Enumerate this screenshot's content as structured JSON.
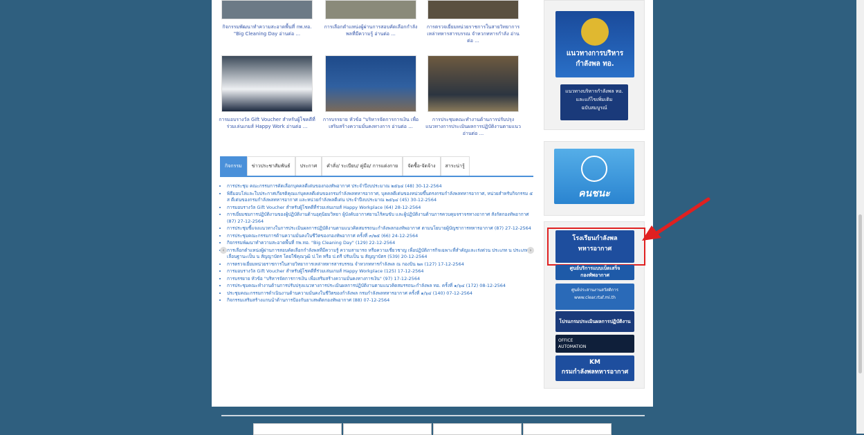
{
  "news_top": [
    {
      "caption": "กิจกรรมพัฒนาทำความสะอาดพื้นที่ กพ.ทอ. \"Big Cleaning Day อ่านต่อ ..."
    },
    {
      "caption": "การเลือกตำแหน่งผู้ผ่านการสอบคัดเลือกกำลังพลที่มีความรู้ อ่านต่อ ..."
    },
    {
      "caption": "การตรวจเยี่ยมหน่วยราชการในสายวิทยาการเหล่าทหารสารบรรณ จำหวกทหารกำลัง อ่านต่อ ..."
    }
  ],
  "news_mid": [
    {
      "caption": "การมอบรางวัล Gift Voucher สำหรับผู้โชคดีที่ร่วมเล่นเกมส์ Happy Work อ่านต่อ ..."
    },
    {
      "caption": "การบรรยาย หัวข้อ \"บริหารจัดการการเงิน เพื่อเสริมสร้างความมั่นคงทางการ อ่านต่อ ..."
    },
    {
      "caption": "การประชุมคณะทำงานด้านการปรับปรุงแนวทางการประเมินผลการปฏิบัติงานตามแนว อ่านต่อ ..."
    }
  ],
  "tabs": [
    "กิจกรรม",
    "ข่าวประชาสัมพันธ์",
    "ประกาศ",
    "คำสั่ง/ ระเบียบ/ คู่มือ/ การแต่งกาย",
    "จัดซื้อ-จัดจ้าง",
    "สาระน่ารู้"
  ],
  "news_list": [
    "การประชุม คณะกรรมการคัดเลือกบุคคลดีเด่นของกองทัพอากาศ ประจำปีงบประมาณ ๒๕๖๔ (48) 30-12-2564",
    "พิธีมอบโล่และใบประกาศเกียรติคุณแก่บุคคลดีเด่นของกรมกำลังพลทหารอากาศ, บุคคลดีเด่นของหน่วยขึ้นตรงกรมกำลังพลทหารอากาศ, หน่วยสำหรับกิจกรรม ๕ ส ดีเด่นของกรมกำลังพลทหารอากาศ และหน่วยกำลังพลดีเด่น ประจำปีงบประมาณ ๒๕๖๔ (45) 30-12-2564",
    "การมอบรางวัล Gift Voucher สำหรับผู้โชคดีที่ร่วมเล่นเกมส์ Happy Workplace (64) 28-12-2564",
    "การเยี่ยมชมการปฏิบัติงานของผู้ปฏิบัติงานด้านอุตุนิยมวิทยา ผู้บังคับอากาศยานไร้คนขับ และผู้ปฏิบัติงานด้านการควบคุมจราจรทางอากาศ สังกัดกองทัพอากาศ (87) 27-12-2564",
    "การประชุมชี้แจงแนวทางในการประเมินผลการปฏิบัติงานตามแนวคิดสมรรถนะกำลังพลกองทัพอากาศ ตามนโยบายผู้บัญชาการทหารอากาศ (87) 27-12-2564",
    "การประชุมคณะกรรมการด้านความมั่นคงในชีวิตของกองทัพอากาศ ครั้งที่ ๓/๒๕ (66) 24-12-2564",
    "กิจกรรมพัฒนาทำความสะอาดพื้นที่ กพ.ทอ. \"Big Cleaning Day\" (129) 22-12-2564",
    "การเลือกตำแหน่งผู้ผ่านการสอบคัดเลือกกำลังพลที่มีความรู้ ความสามารถ หรือความเชี่ยวชาญ เพื่อปฏิบัติภารกิจเฉพาะที่สำคัญและเร่งด่วน ประเภท น ประเภท น เลื่อนฐานะเป็น น สัญญาบัตร โดยใช้คุณวุฒิ ป.โท หรือ ป.ตรี ปรับเป็น น สัญญาบัตร (539) 20-12-2564",
    "การตรวจเยี่ยมหน่วยราชการในสายวิทยาการเหล่าทหารสารบรรณ จำหวกทหารกำลังพล ณ กองบิน ๒๓ (127) 17-12-2564",
    "การมอบรางวัล Gift Voucher สำหรับผู้โชคดีที่ร่วมเล่นเกมส์ Happy Workplace (125) 17-12-2564",
    "การบรรยาย หัวข้อ \"บริหารจัดการการเงิน เพื่อเสริมสร้างความมั่นคงทางการเงิน\" (97) 17-12-2564",
    "การประชุมคณะทำงานด้านการปรับปรุงแนวทางการประเมินผลการปฏิบัติงานตามแนวคิดสมรรถนะกำลังพล ทอ. ครั้งที่ ๑/๖๔ (172) 08-12-2564",
    "ประชุมคณะกรรมการดำเนินงานด้านความมั่นคงในชีวิตของกำลังพล กรมกำลังพลทหารอากาศ ครั้งที่ ๑/๖๔ (140) 07-12-2564",
    "กิจกรรมเสริมสร้างแกนนำด้านการป้องกันยาเสพติดกองทัพอากาศ (88) 07-12-2564"
  ],
  "carousel": {
    "prev": "‹",
    "next": "›"
  },
  "right": {
    "banner1_title": "แนวทางการบริหาร",
    "banner1_sub": "กำลังพล ทอ.",
    "banner2_l1": "แนวทางบริหารกำลังพล ทอ.",
    "banner2_l2": "และแก้ไขเพิ่มเติม",
    "banner2_l3": "ฉบับสมบูรณ์",
    "people_label": "คนชนะ",
    "school_l1": "โรงเรียนกำลังพล",
    "school_l2": "ทหารอากาศ",
    "center_l1": "ศูนย์บริการแบบเบ็ดเสร็จ",
    "center_l2": "กองทัพอากาศ",
    "welfare_l1": "ศูนย์ประสานงานสวัสดิการ",
    "welfare_l2": "www.clear.rtaf.mi.th",
    "eval_label": "โปรแกรมประเมินผลการปฏิบัติงาน",
    "oa_l1": "OFFICE",
    "oa_l2": "AUTOMATION",
    "km_l1": "KM",
    "km_l2": "กรมกำลังพลทหารอากาศ"
  },
  "colors": {
    "bg": "#2f5f7f",
    "accent": "#4a90d9",
    "highlight": "#e02020"
  }
}
